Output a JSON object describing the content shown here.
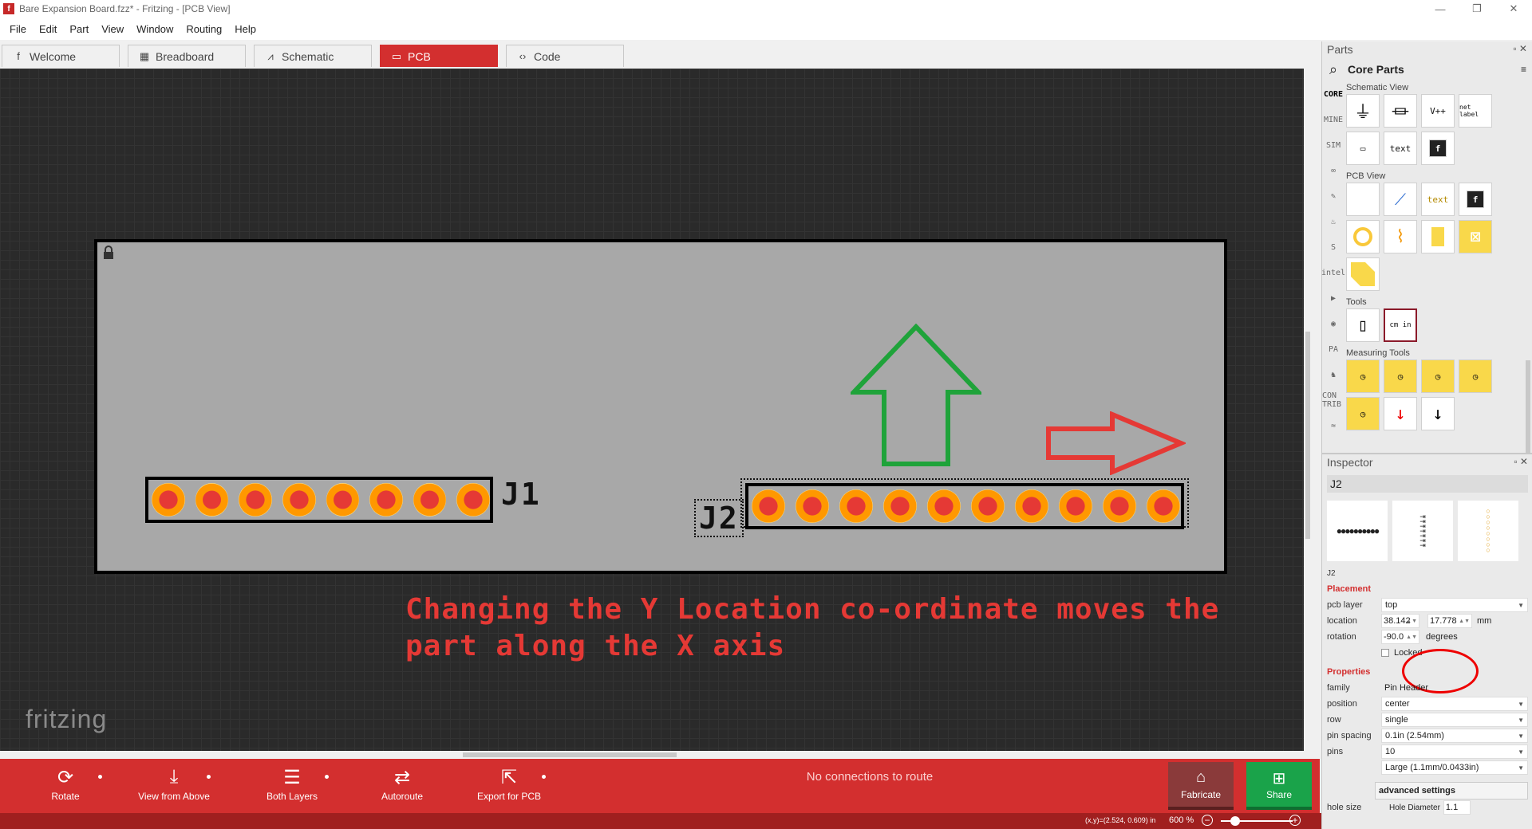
{
  "window": {
    "title": "Bare Expansion Board.fzz* - Fritzing - [PCB View]",
    "app_letter": "f"
  },
  "menu": [
    "File",
    "Edit",
    "Part",
    "View",
    "Window",
    "Routing",
    "Help"
  ],
  "tabs": [
    {
      "label": "Welcome",
      "icon": "f"
    },
    {
      "label": "Breadboard",
      "icon": "▦"
    },
    {
      "label": "Schematic",
      "icon": "⩘"
    },
    {
      "label": "PCB",
      "icon": "▭"
    },
    {
      "label": "Code",
      "icon": "‹›"
    }
  ],
  "canvas": {
    "j1_label": "J1",
    "j2_label": "J2",
    "annotation_line1": "Changing the Y Location co-ordinate moves the",
    "annotation_line2": "part along the X axis",
    "logo": "fritzing",
    "colors": {
      "arrow_up": "#1fa33a",
      "arrow_right": "#e53935",
      "annotation": "#e53935"
    }
  },
  "toolbar": {
    "rotate": "Rotate",
    "view_from_above": "View from Above",
    "both_layers": "Both Layers",
    "autoroute": "Autoroute",
    "export_pcb": "Export for PCB",
    "routing_status": "No connections to route",
    "fabricate": "Fabricate",
    "share": "Share"
  },
  "status": {
    "coords": "(x,y)=(2.524, 0.609) in",
    "zoom": "600 %",
    "zoom_out": "−",
    "zoom_in": "+"
  },
  "parts": {
    "title": "Parts",
    "bin_name": "Core Parts",
    "bins": [
      "CORE",
      "MINE",
      "SIM",
      "∞",
      "✎",
      "♨",
      "S",
      "intel",
      "▶",
      "◉",
      "PA",
      "♞",
      "CON TRIB",
      "≈"
    ],
    "schematic_view": "Schematic View",
    "schematic_items": [
      "⏚",
      "⏛",
      "V++",
      "net label",
      "▭",
      "text",
      "f"
    ],
    "pcb_view": "PCB View",
    "tools": "Tools",
    "tools_items": [
      "▯",
      "cm in"
    ],
    "measuring_tools": "Measuring Tools"
  },
  "inspector": {
    "title": "Inspector",
    "part_name": "J2",
    "sub_name": "J2",
    "placement": "Placement",
    "pcb_layer_label": "pcb layer",
    "pcb_layer": "top",
    "location_label": "location",
    "loc_x": "38.142",
    "loc_y": "17.778",
    "loc_unit": "mm",
    "rotation_label": "rotation",
    "rotation": "-90.0",
    "rotation_unit": "degrees",
    "locked": "Locked",
    "properties": "Properties",
    "props": [
      {
        "label": "family",
        "value": "Pin Header",
        "select": false
      },
      {
        "label": "position",
        "value": "center",
        "select": true
      },
      {
        "label": "row",
        "value": "single",
        "select": true
      },
      {
        "label": "pin spacing",
        "value": "0.1in (2.54mm)",
        "select": true
      },
      {
        "label": "pins",
        "value": "10",
        "select": true
      },
      {
        "label": "",
        "value": "Large (1.1mm/0.0433in)",
        "select": true
      }
    ],
    "advanced": "advanced settings",
    "hole_size_label": "hole size",
    "hole_diameter": "Hole Diameter",
    "hole_value": "1.1"
  }
}
